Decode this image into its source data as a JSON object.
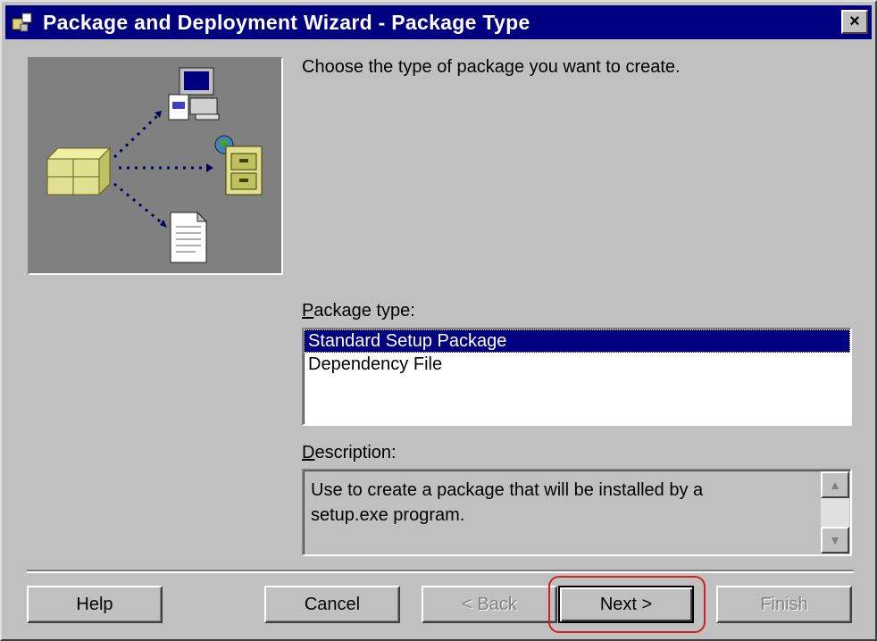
{
  "window": {
    "title": "Package and Deployment Wizard - Package Type",
    "close_label": "×",
    "title_icon": "wizard-icon"
  },
  "main": {
    "prompt": "Choose the type of package you want to create.",
    "package_type_label_accel": "P",
    "package_type_label_rest": "ackage type:",
    "package_types": [
      {
        "label": "Standard Setup Package",
        "selected": true
      },
      {
        "label": "Dependency File",
        "selected": false
      }
    ],
    "description_label_accel": "D",
    "description_label_rest": "escription:",
    "description_lines": [
      "Use to create a package that will be installed by a",
      "setup.exe program."
    ]
  },
  "buttons": {
    "help": "Help",
    "cancel": "Cancel",
    "back": "< Back",
    "next": "Next >",
    "finish": "Finish"
  },
  "colors": {
    "titlebar": "#000080",
    "face": "#c0c0c0",
    "selection": "#000080",
    "highlight_ring": "#d02020"
  }
}
